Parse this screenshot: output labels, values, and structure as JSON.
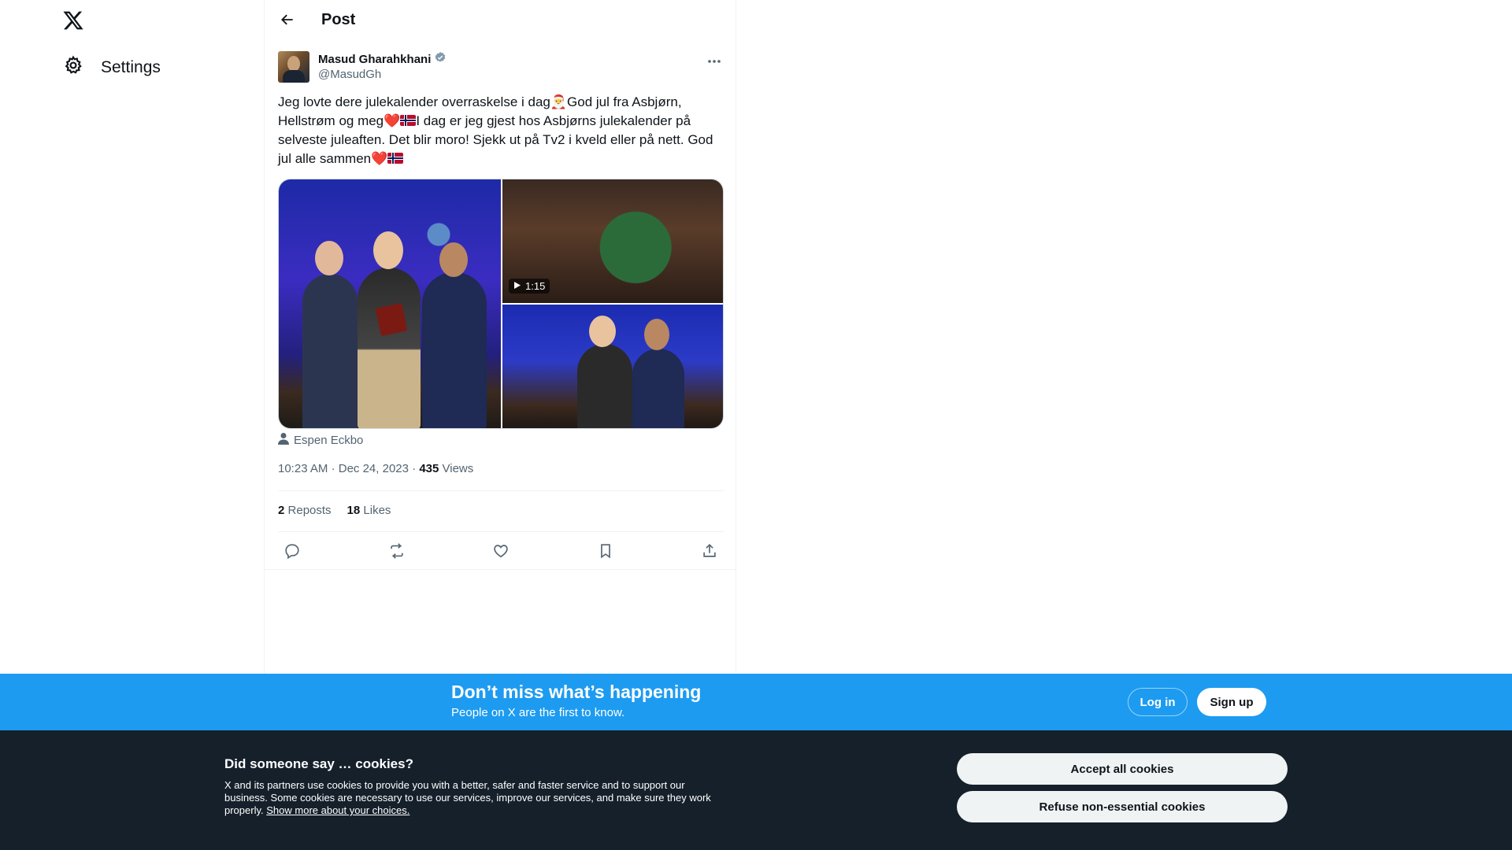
{
  "nav": {
    "logo_icon": "x-logo-icon",
    "settings_label": "Settings",
    "settings_icon": "gear-icon"
  },
  "header": {
    "title": "Post",
    "back_icon": "arrow-left-icon"
  },
  "post": {
    "author_name": "Masud Gharahkhani",
    "author_handle": "@MasudGh",
    "verified_icon": "verified-badge-icon",
    "text_part1": "Jeg lovte dere julekalender overraskelse i dag",
    "emoji_santa": "🎅",
    "text_part2": "God jul fra Asbjørn, Hellstrøm og meg",
    "emoji_heart": "❤️",
    "text_part3": "I dag er jeg gjest hos Asbjørns julekalender på selveste juleaften. Det blir moro! Sjekk ut på Tv2 i kveld eller på nett. God jul alle sammen",
    "video_duration": "1:15",
    "tagged_user": "Espen Eckbo",
    "time": "10:23 AM",
    "date": "Dec 24, 2023",
    "views_count": "435",
    "views_label": "Views",
    "reposts_count": "2",
    "reposts_label": "Reposts",
    "likes_count": "18",
    "likes_label": "Likes"
  },
  "signup": {
    "title": "Don’t miss what’s happening",
    "subtitle": "People on X are the first to know.",
    "login_label": "Log in",
    "signup_label": "Sign up"
  },
  "cookies": {
    "title": "Did someone say … cookies?",
    "text": "X and its partners use cookies to provide you with a better, safer and faster service and to support our business. Some cookies are necessary to use our services, improve our services, and make sure they work properly.",
    "link_label": "Show more about your choices.",
    "accept_label": "Accept all cookies",
    "refuse_label": "Refuse non-essential cookies"
  },
  "colors": {
    "accent": "#1d9bf0",
    "text_primary": "#0f1419",
    "text_secondary": "#536471",
    "cookie_bg": "#15202b",
    "heart": "#e0245e"
  }
}
